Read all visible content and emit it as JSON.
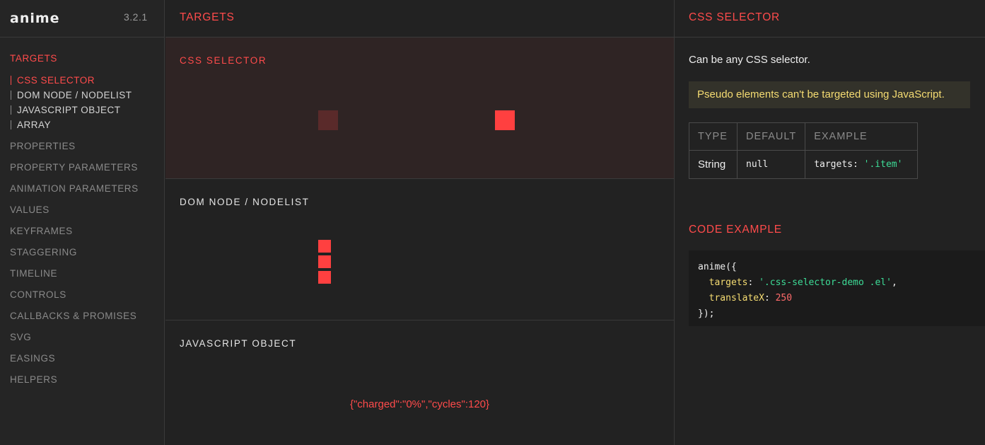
{
  "sidebar": {
    "logo": "anime",
    "version": "3.2.1",
    "active_section": "TARGETS",
    "subitems": [
      "CSS SELECTOR",
      "DOM NODE / NODELIST",
      "JAVASCRIPT OBJECT",
      "ARRAY"
    ],
    "sections": [
      "PROPERTIES",
      "PROPERTY PARAMETERS",
      "ANIMATION PARAMETERS",
      "VALUES",
      "KEYFRAMES",
      "STAGGERING",
      "TIMELINE",
      "CONTROLS",
      "CALLBACKS & PROMISES",
      "SVG",
      "EASINGS",
      "HELPERS"
    ]
  },
  "main": {
    "title": "TARGETS",
    "demos": [
      {
        "title": "CSS SELECTOR"
      },
      {
        "title": "DOM NODE / NODELIST"
      },
      {
        "title": "JAVASCRIPT OBJECT",
        "output": "{\"charged\":\"0%\",\"cycles\":120}"
      }
    ]
  },
  "panel": {
    "title": "CSS SELECTOR",
    "description": "Can be any CSS selector.",
    "note": "Pseudo elements can't be targeted using JavaScript.",
    "table": {
      "headers": [
        "TYPE",
        "DEFAULT",
        "EXAMPLE"
      ],
      "type": "String",
      "default": "null",
      "example_key": "targets:",
      "example_value": "'.item'"
    },
    "code_title": "CODE EXAMPLE",
    "code": {
      "line1": "anime({",
      "prop1": "targets",
      "val1": "'.css-selector-demo .el'",
      "prop2": "translateX",
      "val2": "250",
      "line4": "});"
    }
  },
  "colors": {
    "accent": "#ff4b4b",
    "note_text": "#f5dc72",
    "code_green": "#3ddc97"
  }
}
